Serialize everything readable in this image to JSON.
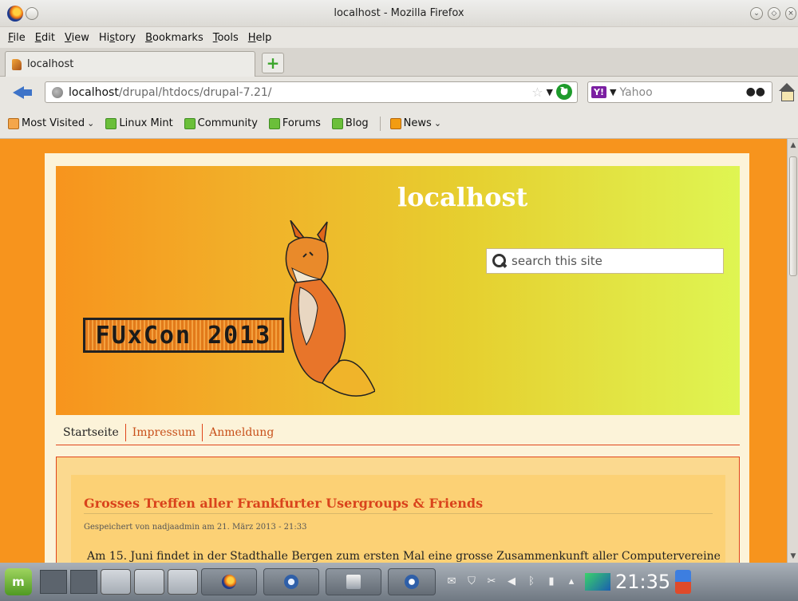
{
  "window": {
    "title": "localhost - Mozilla Firefox"
  },
  "menubar": {
    "items": [
      {
        "label": "File",
        "accel": "F"
      },
      {
        "label": "Edit",
        "accel": "E"
      },
      {
        "label": "View",
        "accel": "V"
      },
      {
        "label": "History",
        "accel": "s"
      },
      {
        "label": "Bookmarks",
        "accel": "B"
      },
      {
        "label": "Tools",
        "accel": "T"
      },
      {
        "label": "Help",
        "accel": "H"
      }
    ]
  },
  "tabs": [
    {
      "label": "localhost",
      "active": true
    }
  ],
  "navbar": {
    "url_host": "localhost",
    "url_path": "/drupal/htdocs/drupal-7.21/",
    "search_placeholder": "Yahoo",
    "search_engine_badge": "Y!"
  },
  "bookmarks": [
    {
      "label": "Most Visited",
      "icon": "most-visited-icon",
      "dropdown": true
    },
    {
      "label": "Linux Mint",
      "icon": "mint-bookmark-icon"
    },
    {
      "label": "Community",
      "icon": "mint-bookmark-icon"
    },
    {
      "label": "Forums",
      "icon": "mint-bookmark-icon"
    },
    {
      "label": "Blog",
      "icon": "mint-bookmark-icon"
    },
    {
      "label": "News",
      "icon": "rss-icon",
      "dropdown": true
    }
  ],
  "site": {
    "name": "localhost",
    "search_placeholder": "search this site",
    "logo_text": "FUxCon 2013",
    "nav": [
      "Startseite",
      "Impressum",
      "Anmeldung"
    ],
    "node": {
      "title": "Grosses Treffen aller Frankfurter Usergroups & Friends",
      "meta": "Gespeichert von nadjaadmin am 21. März 2013 - 21:33",
      "body": "Am 15. Juni findet in der Stadthalle Bergen zum ersten Mal eine grosse Zusammenkunft aller Computervereine"
    }
  },
  "taskbar": {
    "menu_label": "m",
    "clock": "21:35"
  },
  "colors": {
    "page_background": "#f7941d",
    "link": "#c8501a",
    "title_red": "#d9431c"
  }
}
